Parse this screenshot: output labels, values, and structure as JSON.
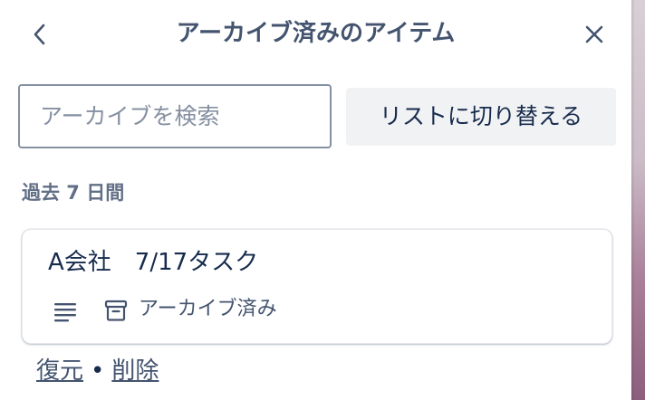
{
  "header": {
    "title": "アーカイブ済みのアイテム",
    "back_icon": "chevron-left-icon",
    "close_icon": "close-icon"
  },
  "search": {
    "placeholder": "アーカイブを検索",
    "value": ""
  },
  "switch_button": {
    "label": "リストに切り替える"
  },
  "section": {
    "title": "過去 7 日間"
  },
  "cards": [
    {
      "title": "A会社　7/17タスク",
      "description_icon": "description-icon",
      "archive_icon": "archive-icon",
      "badge": "アーカイブ済み"
    }
  ],
  "actions": {
    "restore": "復元",
    "separator": "•",
    "delete": "削除"
  },
  "colors": {
    "title": "#44546f",
    "text": "#172b4d",
    "subtle": "#626f86",
    "border": "#8590a2",
    "button_bg": "#f1f2f4"
  }
}
